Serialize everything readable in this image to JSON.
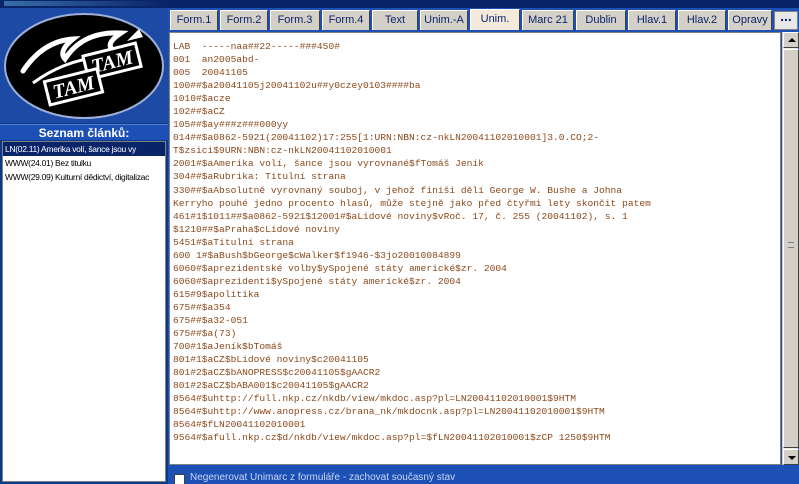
{
  "logo": {
    "text_top": "TAM",
    "text_bottom": "TAM"
  },
  "sidebar": {
    "title": "Seznam článků:",
    "items": [
      {
        "label": "LN(02.11) Amerika volí, šance jsou vy",
        "selected": true
      },
      {
        "label": "WWW(24.01) Bez titulku",
        "selected": false
      },
      {
        "label": "WWW(29.09) Kulturní dědictví, digitalizac",
        "selected": false
      }
    ]
  },
  "tabs": [
    {
      "label": "Form.1",
      "active": false
    },
    {
      "label": "Form.2",
      "active": false
    },
    {
      "label": "Form.3",
      "active": false
    },
    {
      "label": "Form.4",
      "active": false
    },
    {
      "label": "Text",
      "active": false
    },
    {
      "label": "Unim.-A",
      "active": false
    },
    {
      "label": "Unim.",
      "active": true
    },
    {
      "label": "Marc 21",
      "active": false
    },
    {
      "label": "Dublin",
      "active": false
    },
    {
      "label": "Hlav.1",
      "active": false
    },
    {
      "label": "Hlav.2",
      "active": false
    },
    {
      "label": "Opravy",
      "active": false
    }
  ],
  "tab_more_label": "...",
  "record_lines": [
    "LAB  -----naa##22-----###450#",
    "001  an2005abd-",
    "005  20041105",
    "100##$a20041105j20041102u##y0czey0103####ba",
    "1010#$acze",
    "102##$aCZ",
    "105##$ay###z###000yy",
    "014##$a0862-5921(20041102)17:255[1:URN:NBN:cz-nkLN20041102010001]3.0.CO;2-",
    "T$zsici$9URN:NBN:cz-nkLN20041102010001",
    "2001#$aAmerika volí, šance jsou vyrovnané$fTomáš Jeník",
    "304##$aRubrika: Titulní strana",
    "330##$aAbsolutně vyrovnaný souboj, v jehož finiši dělí George W. Bushe a Johna",
    "Kerryho pouhé jedno procento hlasů, může stejně jako před čtyřmi lety skončit patem",
    "461#1$1011##$a0862-5921$12001#$aLidové noviny$vRoč. 17, č. 255 (20041102), s. 1",
    "$1210##$aPraha$cLidové noviny",
    "5451#$aTitulní strana",
    "600 1#$aBush$bGeorge$cWalker$f1946-$3jo20010084899",
    "6060#$aprezidentské volby$ySpojené státy americké$zr. 2004",
    "6060#$aprezidenti$ySpojené státy americké$zr. 2004",
    "615#9$apolitika",
    "675##$a354",
    "675##$a32-051",
    "675##$a(73)",
    "700#1$aJeník$bTomáš",
    "801#1$aCZ$bLidové noviny$c20041105",
    "801#2$aCZ$bANOPRESS$c20041105$gAACR2",
    "801#2$aCZ$bABA001$c20041105$gAACR2",
    "8564#$uhttp://full.nkp.cz/nkdb/view/mkdoc.asp?pl=LN20041102010001$9HTM",
    "8564#$uhttp://www.anopress.cz/brana_nk/mkdocnk.asp?pl=LN20041102010001$9HTM",
    "8564#$fLN20041102010001",
    "9564#$afull.nkp.cz$d/nkdb/view/mkdoc.asp?pl=$fLN20041102010001$zCP 1250$9HTM"
  ],
  "bottom": {
    "checkbox_label": "Negenerovat Unimarc z formuláře - zachovat současný stav",
    "checked": false
  },
  "colors": {
    "panel_blue": "#1d50b5",
    "record_text": "#8b4a1c",
    "selected_item": "#0a246a"
  }
}
